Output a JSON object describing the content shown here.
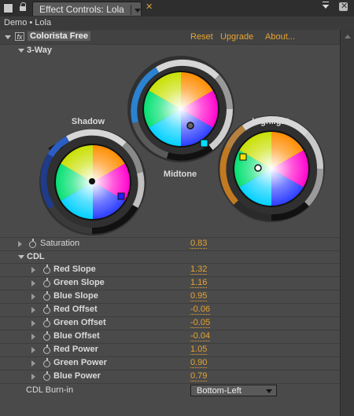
{
  "tab": {
    "title": "Effect Controls: Lola"
  },
  "breadcrumb": "Demo • Lola",
  "effect": {
    "name": "Colorista Free",
    "links": {
      "reset": "Reset",
      "upgrade": "Upgrade",
      "about": "About..."
    }
  },
  "three_way": {
    "label": "3-Way",
    "wheels": {
      "shadow": {
        "label": "Shadow"
      },
      "midtone": {
        "label": "Midtone"
      },
      "highlight": {
        "label": "Highlight"
      }
    }
  },
  "saturation": {
    "label": "Saturation",
    "value": "0.83"
  },
  "cdl": {
    "label": "CDL",
    "params": [
      {
        "label": "Red Slope",
        "value": "1.32"
      },
      {
        "label": "Green Slope",
        "value": "1.16"
      },
      {
        "label": "Blue Slope",
        "value": "0.95"
      },
      {
        "label": "Red Offset",
        "value": "-0.06"
      },
      {
        "label": "Green Offset",
        "value": "-0.05"
      },
      {
        "label": "Blue Offset",
        "value": "-0.04"
      },
      {
        "label": "Red Power",
        "value": "1.05"
      },
      {
        "label": "Green Power",
        "value": "0.90"
      },
      {
        "label": "Blue Power",
        "value": "0.79"
      }
    ]
  },
  "burn_in": {
    "label": "CDL Burn-in",
    "selected": "Bottom-Left"
  },
  "icons": [
    "lock-icon",
    "fx-badge-icon",
    "stopwatch-icon",
    "disclosure-triangle-icon",
    "panel-menu-icon",
    "close-icon"
  ]
}
